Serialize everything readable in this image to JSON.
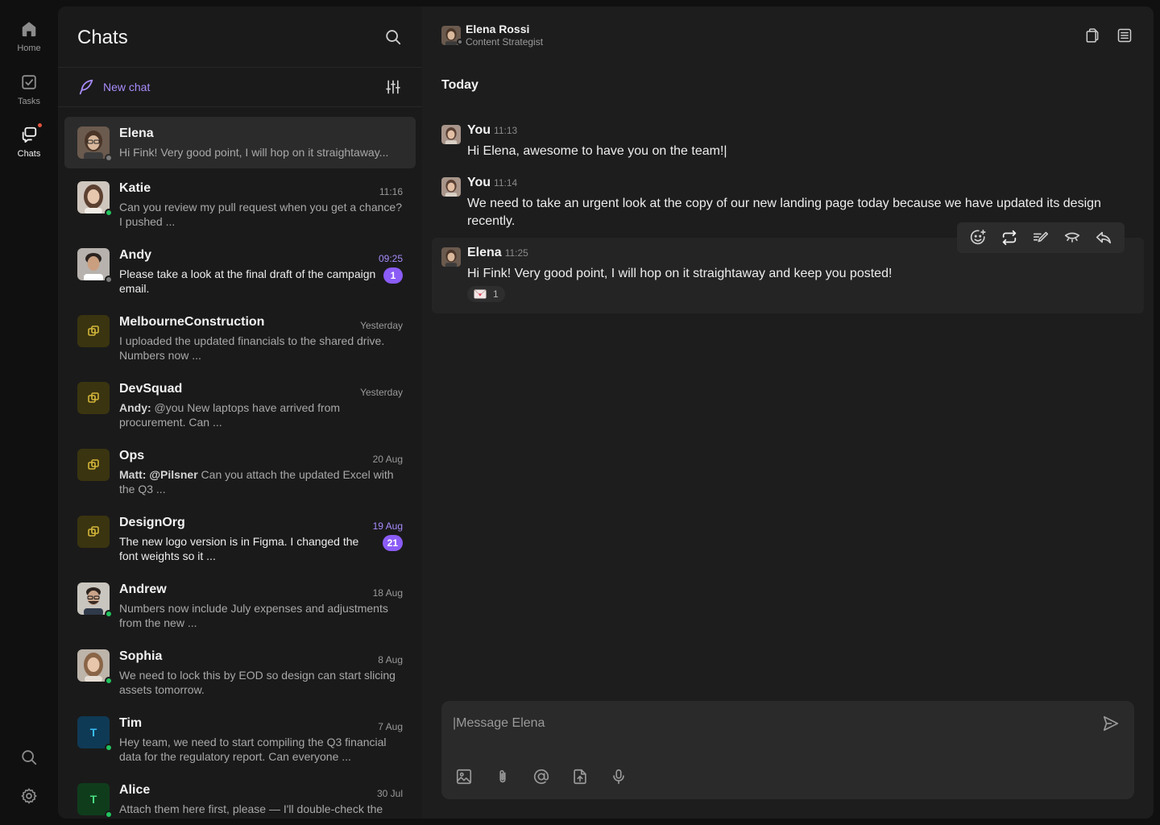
{
  "rail": {
    "items": [
      {
        "label": "Home",
        "icon": "home-icon"
      },
      {
        "label": "Tasks",
        "icon": "tasks-icon"
      },
      {
        "label": "Chats",
        "icon": "chats-icon",
        "active": true
      }
    ],
    "bottom": [
      {
        "icon": "search-icon"
      },
      {
        "icon": "gear-icon"
      }
    ]
  },
  "list": {
    "title": "Chats",
    "new_chat_label": "New chat",
    "chats": [
      {
        "name": "Elena",
        "time": "",
        "preview": "Hi Fink! Very good point, I will hop on it straightaway...",
        "status": "away",
        "selected": true
      },
      {
        "name": "Katie",
        "time": "11:16",
        "preview": "Can you review my pull request when you get a chance? I pushed ...",
        "status": "online"
      },
      {
        "name": "Andy",
        "time": "09:25",
        "preview": "Please take a look at the final draft of the campaign email.",
        "status": "away",
        "unread": "1"
      },
      {
        "name": "MelbourneConstruction",
        "time": "Yesterday",
        "preview": "I uploaded the updated financials to the shared drive. Numbers now ...",
        "group": true
      },
      {
        "name": "DevSquad",
        "time": "Yesterday",
        "sender": "Andy:",
        "preview": " @you New laptops have arrived from procurement. Can ...",
        "group": true
      },
      {
        "name": "Ops",
        "time": "20 Aug",
        "sender": "Matt: @Pilsner",
        "preview": " Can you attach the updated Excel with the Q3 ...",
        "group": true
      },
      {
        "name": "DesignOrg",
        "time": "19 Aug",
        "preview": "The new logo version is in Figma. I changed the font weights so it ...",
        "group": true,
        "unread": "21"
      },
      {
        "name": "Andrew",
        "time": "18 Aug",
        "preview": "Numbers now include July expenses and adjustments from the new ...",
        "status": "online"
      },
      {
        "name": "Sophia",
        "time": "8 Aug",
        "preview": "We need to lock this by EOD so design can start slicing assets tomorrow.",
        "status": "online"
      },
      {
        "name": "Tim",
        "time": "7 Aug",
        "preview": "Hey team, we need to start compiling the Q3 financial data for the regulatory report. Can everyone ...",
        "status": "online",
        "letter": "T"
      },
      {
        "name": "Alice",
        "time": "30 Jul",
        "preview": "Attach them here first, please — I'll double-check the",
        "status": "online",
        "letter": "T"
      }
    ]
  },
  "conversation": {
    "contact_name": "Elena Rossi",
    "contact_role": "Content Strategist",
    "day_label": "Today",
    "messages": [
      {
        "author": "You",
        "time": "11:13",
        "text": "Hi Elena, awesome to have you on the team!|"
      },
      {
        "author": "You",
        "time": "11:14",
        "text": "We need to take an urgent look at the copy of our new landing page today because we have updated its design recently."
      },
      {
        "author": "Elena",
        "time": "11:25",
        "text": "Hi Fink! Very good point, I will hop on it straightaway and keep you posted!",
        "reaction_count": "1"
      }
    ],
    "composer_placeholder": "|Message Elena"
  },
  "colors": {
    "accent": "#8b5cf6",
    "online": "#22c55e",
    "away": "#7a7a7a",
    "notification": "#e5533d"
  }
}
